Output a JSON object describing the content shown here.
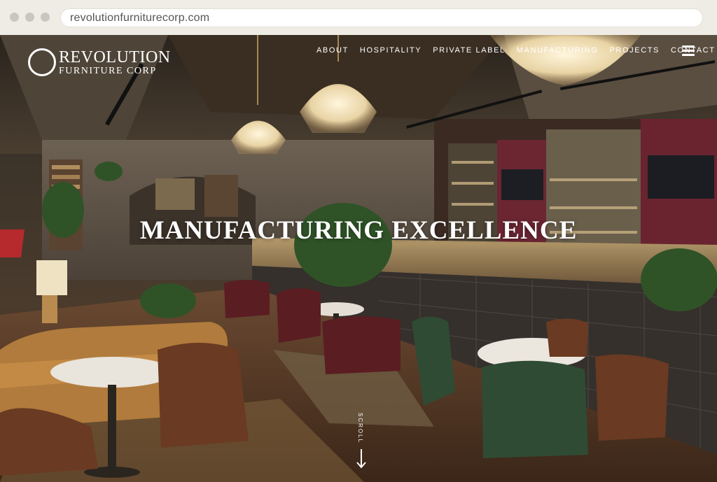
{
  "browser": {
    "url": "revolutionfurniturecorp.com"
  },
  "logo": {
    "line1": "REVOLUTION",
    "line2": "FURNITURE CORP"
  },
  "nav": {
    "items": [
      {
        "label": "ABOUT"
      },
      {
        "label": "HOSPITALITY"
      },
      {
        "label": "PRIVATE LABEL"
      },
      {
        "label": "MANUFACTURING"
      },
      {
        "label": "PROJECTS"
      },
      {
        "label": "CONTACT"
      }
    ],
    "menu_icon": "hamburger-icon"
  },
  "hero": {
    "headline": "MANUFACTURING EXCELLENCE",
    "scroll_label": "SCROLL",
    "scroll_icon": "arrow-down-icon"
  },
  "colors": {
    "chrome_bg": "#efece6",
    "text_light": "#ffffff",
    "wood_dark": "#3a2b1f",
    "velvet": "#5a1d22",
    "green_chair": "#2f4b34"
  }
}
